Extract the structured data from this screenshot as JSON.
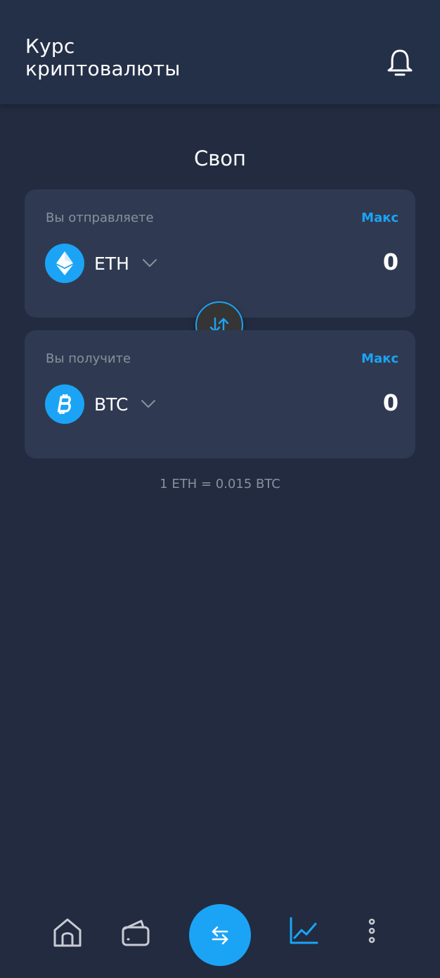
{
  "header": {
    "title": "Курс криптовалюты",
    "bell_icon": "bell-icon"
  },
  "page": {
    "title": "Своп"
  },
  "send": {
    "label": "Вы отправляете",
    "max_label": "Макс",
    "coin": "ETH",
    "coin_icon": "ethereum-icon",
    "amount": "0"
  },
  "receive": {
    "label": "Вы получите",
    "max_label": "Макс",
    "coin": "BTC",
    "coin_icon": "bitcoin-icon",
    "amount": "0"
  },
  "swap_toggle_icon": "swap-vertical-icon",
  "rate": "1 ETH = 0.015 BTC",
  "bottom_nav": {
    "items": [
      {
        "icon": "home-icon",
        "active": false
      },
      {
        "icon": "wallet-icon",
        "active": false
      },
      {
        "icon": "swap-horizontal-icon",
        "active": true
      },
      {
        "icon": "chart-icon",
        "active": false
      },
      {
        "icon": "more-vertical-icon",
        "active": false
      }
    ]
  },
  "colors": {
    "background": "#222b40",
    "header": "#243048",
    "card": "#2f3a52",
    "accent": "#1ba4f5",
    "muted_text": "#8a909d"
  }
}
